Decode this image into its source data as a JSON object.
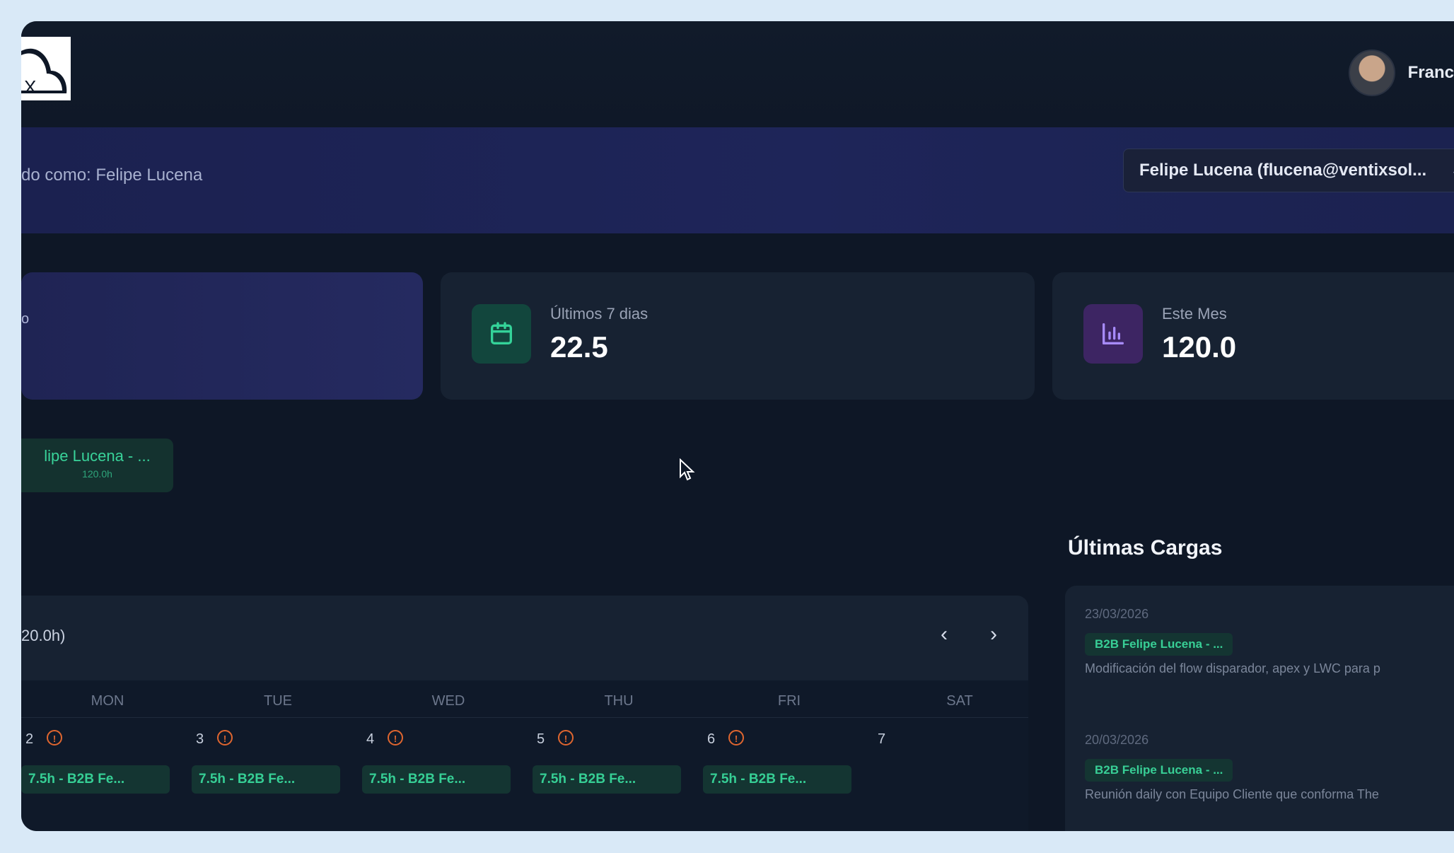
{
  "header": {
    "user_name": "Franc"
  },
  "impersonation": {
    "text": "do como: Felipe Lucena",
    "select_value": "Felipe Lucena (flucena@ventixsol..."
  },
  "stats": {
    "first_card_fragment": "o",
    "week": {
      "label": "Últimos 7 dias",
      "value": "22.5"
    },
    "month": {
      "label": "Este Mes",
      "value": "120.0"
    }
  },
  "project_filter": {
    "name": "lipe Lucena - ...",
    "hours": "120.0h"
  },
  "calendar": {
    "title": "20.0h)",
    "prev_label": "‹",
    "next_label": "›",
    "day_names": [
      "MON",
      "TUE",
      "WED",
      "THU",
      "FRI",
      "SAT"
    ],
    "cells": [
      {
        "day": "2",
        "warning": true,
        "entry": "7.5h - B2B Fe..."
      },
      {
        "day": "3",
        "warning": true,
        "entry": "7.5h - B2B Fe..."
      },
      {
        "day": "4",
        "warning": true,
        "entry": "7.5h - B2B Fe..."
      },
      {
        "day": "5",
        "warning": true,
        "entry": "7.5h - B2B Fe..."
      },
      {
        "day": "6",
        "warning": true,
        "entry": "7.5h - B2B Fe..."
      },
      {
        "day": "7",
        "warning": false,
        "entry": ""
      }
    ]
  },
  "ultimas_cargas": {
    "title": "Últimas Cargas",
    "items": [
      {
        "date": "23/03/2026",
        "project": "B2B Felipe Lucena - ...",
        "description": "Modificación del flow disparador, apex y LWC para p"
      },
      {
        "date": "20/03/2026",
        "project": "B2B Felipe Lucena - ...",
        "description": "Reunión daily con Equipo Cliente que conforma The"
      }
    ]
  },
  "colors": {
    "background": "#0e1726",
    "card": "#172232",
    "accent_green": "#36cf95",
    "accent_purple": "#8b5cf6",
    "warning_orange": "#e0662f",
    "impersonation_bar": "#1e2559"
  }
}
